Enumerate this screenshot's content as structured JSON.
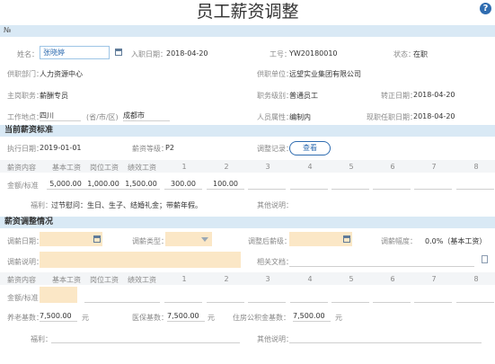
{
  "header": {
    "title": "员工薪资调整",
    "help": "?"
  },
  "no_label": "№",
  "basic": {
    "name_label": "姓名：",
    "name_value": "张晓婷",
    "entry_label": "入职日期：",
    "entry_value": "2018-04-20",
    "emp_no_label": "工号：",
    "emp_no_value": "YW20180010",
    "status_label": "状态：",
    "status_value": "在职",
    "dept_label": "供职部门：",
    "dept_value": "人力资源中心",
    "unit_label": "供职单位：",
    "unit_value": "远望实业集团有限公司",
    "post_label": "主岗职务：",
    "post_value": "薪酬专员",
    "level_label": "职务级别：",
    "level_value": "普通员工",
    "regular_label": "转正日期：",
    "regular_value": "2018-04-20",
    "workplace_label": "工作地点：",
    "workplace_province": "四川",
    "workplace_sep": "(省/市/区)",
    "workplace_city": "成都市",
    "attr_label": "人员属性：",
    "attr_value": "编制内",
    "curpost_label": "现职任职日期：",
    "curpost_value": "2018-04-20"
  },
  "current": {
    "section_title": "当前薪资标准",
    "exec_label": "执行日期：",
    "exec_value": "2019-01-01",
    "grade_label": "薪资等级：",
    "grade_value": "P2",
    "record_label": "调整记录：",
    "view_button": "查看",
    "header_label": "薪资内容",
    "columns": [
      "基本工资",
      "岗位工资",
      "绩效工资",
      "1",
      "2",
      "3",
      "4",
      "5",
      "6",
      "7",
      "8"
    ],
    "row_label": "金额/标准",
    "values": [
      "5,000.00",
      "1,000.00",
      "1,500.00",
      "300.00",
      "100.00",
      "",
      "",
      "",
      "",
      "",
      ""
    ],
    "welfare_label": "福利：",
    "welfare_value": "过节慰问：生日、生子、结婚礼金；带薪年假。",
    "other_label": "其他说明："
  },
  "adjust": {
    "section_title": "薪资调整情况",
    "date_label": "调薪日期：",
    "type_label": "调薪类型：",
    "after_level_label": "调整后薪级：",
    "range_label": "调薪幅度：",
    "range_value": "0.0%（基本工资）",
    "note_label": "调薪说明：",
    "doc_label": "相关文档：",
    "header_label": "薪资内容",
    "columns": [
      "基本工资",
      "岗位工资",
      "绩效工资",
      "1",
      "2",
      "3",
      "4",
      "5",
      "6",
      "7",
      "8"
    ],
    "row_label": "金额/标准",
    "pension_label": "养老基数：",
    "pension_value": "7,500.00",
    "pension_unit": "元",
    "medical_label": "医保基数：",
    "medical_value": "7,500.00",
    "medical_unit": "元",
    "housing_label": "住房公积金基数：",
    "housing_value": "7,500.00",
    "housing_unit": "元",
    "welfare_label": "福利：",
    "other_label": "其他说明："
  }
}
